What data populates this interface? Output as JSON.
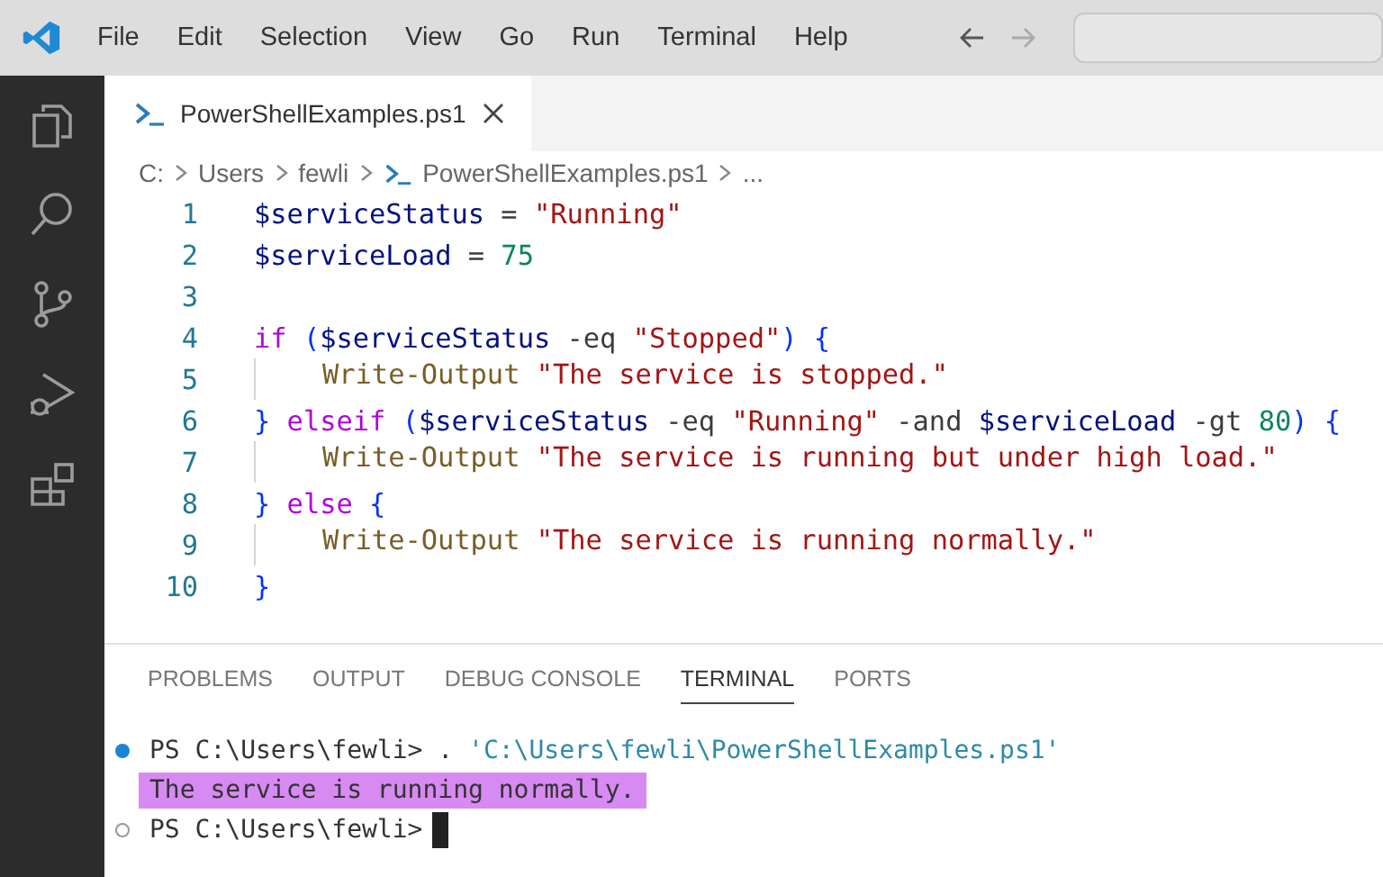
{
  "menu": [
    "File",
    "Edit",
    "Selection",
    "View",
    "Go",
    "Run",
    "Terminal",
    "Help"
  ],
  "tabs": [
    {
      "label": "PowerShellExamples.ps1",
      "selected": true
    }
  ],
  "breadcrumbs": [
    "C:",
    "Users",
    "fewli",
    "PowerShellExamples.ps1",
    "..."
  ],
  "code": [
    {
      "number": "1",
      "tokens": [
        {
          "kind": "var",
          "text": "$serviceStatus"
        },
        {
          "kind": "op",
          "text": " = "
        },
        {
          "kind": "str",
          "text": "\"Running\""
        }
      ]
    },
    {
      "number": "2",
      "tokens": [
        {
          "kind": "var",
          "text": "$serviceLoad"
        },
        {
          "kind": "op",
          "text": " = "
        },
        {
          "kind": "num",
          "text": "75"
        }
      ]
    },
    {
      "number": "3"
    },
    {
      "number": "4",
      "tokens": [
        {
          "kind": "kw",
          "text": "if"
        },
        {
          "kind": "brace",
          "text": " ("
        },
        {
          "kind": "var",
          "text": "$serviceStatus"
        },
        {
          "kind": "op",
          "text": " -eq "
        },
        {
          "kind": "str",
          "text": "\"Stopped\""
        },
        {
          "kind": "brace",
          "text": ") {"
        }
      ]
    },
    {
      "number": "5",
      "indented": true,
      "tokens": [
        {
          "kind": "cmd",
          "text": "Write-Output"
        },
        {
          "kind": "str",
          "text": " \"The service is stopped.\""
        }
      ]
    },
    {
      "number": "6",
      "tokens": [
        {
          "kind": "brace",
          "text": "}"
        },
        {
          "kind": "kw",
          "text": " elseif"
        },
        {
          "kind": "brace",
          "text": " ("
        },
        {
          "kind": "var",
          "text": "$serviceStatus"
        },
        {
          "kind": "op",
          "text": " -eq "
        },
        {
          "kind": "str",
          "text": "\"Running\""
        },
        {
          "kind": "op",
          "text": " -and "
        },
        {
          "kind": "var",
          "text": "$serviceLoad"
        },
        {
          "kind": "op",
          "text": " -gt "
        },
        {
          "kind": "num",
          "text": "80"
        },
        {
          "kind": "brace",
          "text": ") {"
        }
      ]
    },
    {
      "number": "7",
      "indented": true,
      "tokens": [
        {
          "kind": "cmd",
          "text": "Write-Output"
        },
        {
          "kind": "str",
          "text": " \"The service is running but under high load.\""
        }
      ]
    },
    {
      "number": "8",
      "tokens": [
        {
          "kind": "brace",
          "text": "}"
        },
        {
          "kind": "kw",
          "text": " else"
        },
        {
          "kind": "brace",
          "text": " {"
        }
      ]
    },
    {
      "number": "9",
      "indented": true,
      "tokens": [
        {
          "kind": "cmd",
          "text": "Write-Output"
        },
        {
          "kind": "str",
          "text": " \"The service is running normally.\""
        }
      ]
    },
    {
      "number": "10",
      "tokens": [
        {
          "kind": "brace",
          "text": "}"
        }
      ]
    }
  ],
  "panel_tabs": [
    {
      "label": "PROBLEMS",
      "selected": false
    },
    {
      "label": "OUTPUT",
      "selected": false
    },
    {
      "label": "DEBUG CONSOLE",
      "selected": false
    },
    {
      "label": "TERMINAL",
      "selected": true
    },
    {
      "label": "PORTS",
      "selected": false
    }
  ],
  "terminal": [
    {
      "kind": "prompt",
      "succeeded": true,
      "prompt": "PS C:\\Users\\fewli>",
      "command": ". ",
      "argument": "'C:\\Users\\fewli\\PowerShellExamples.ps1'"
    },
    {
      "kind": "output",
      "highlighted": true,
      "text": "The service is running normally."
    },
    {
      "kind": "prompt",
      "succeeded": false,
      "prompt": "PS C:\\Users\\fewli>",
      "cursor": true
    }
  ]
}
